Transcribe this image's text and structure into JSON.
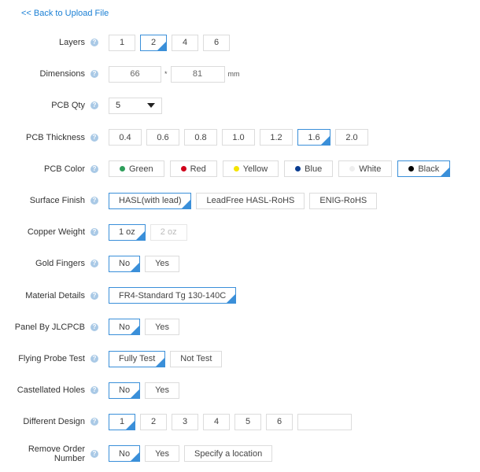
{
  "back_link": "<< Back to Upload File",
  "accent": "#3a8fd9",
  "rows": [
    {
      "key": "layers",
      "label": "Layers",
      "options": [
        "1",
        "2",
        "4",
        "6"
      ],
      "selected": "2"
    },
    {
      "key": "dimensions",
      "label": "Dimensions",
      "type": "dimensions",
      "width": "66",
      "height": "81",
      "separator": "*",
      "unit": "mm"
    },
    {
      "key": "pcb-qty",
      "label": "PCB Qty",
      "type": "select",
      "value": "5"
    },
    {
      "key": "pcb-thickness",
      "label": "PCB Thickness",
      "options": [
        "0.4",
        "0.6",
        "0.8",
        "1.0",
        "1.2",
        "1.6",
        "2.0"
      ],
      "selected": "1.6"
    },
    {
      "key": "pcb-color",
      "label": "PCB Color",
      "type": "color",
      "options": [
        {
          "label": "Green",
          "color": "#2e9e5b"
        },
        {
          "label": "Red",
          "color": "#d0021b"
        },
        {
          "label": "Yellow",
          "color": "#f5e400"
        },
        {
          "label": "Blue",
          "color": "#0a3d91"
        },
        {
          "label": "White",
          "color": "#eeeeee"
        },
        {
          "label": "Black",
          "color": "#000000"
        }
      ],
      "selected": "Black"
    },
    {
      "key": "surface-finish",
      "label": "Surface Finish",
      "options": [
        "HASL(with lead)",
        "LeadFree HASL-RoHS",
        "ENIG-RoHS"
      ],
      "selected": "HASL(with lead)"
    },
    {
      "key": "copper-weight",
      "label": "Copper Weight",
      "options": [
        "1 oz",
        "2 oz"
      ],
      "selected": "1 oz",
      "disabled": [
        "2 oz"
      ]
    },
    {
      "key": "gold-fingers",
      "label": "Gold Fingers",
      "options": [
        "No",
        "Yes"
      ],
      "selected": "No"
    },
    {
      "key": "material-details",
      "label": "Material Details",
      "options": [
        "FR4-Standard Tg 130-140C"
      ],
      "selected": "FR4-Standard Tg 130-140C"
    },
    {
      "key": "panel-by-jlcpcb",
      "label": "Panel By JLCPCB",
      "options": [
        "No",
        "Yes"
      ],
      "selected": "No"
    },
    {
      "key": "flying-probe-test",
      "label": "Flying Probe Test",
      "options": [
        "Fully Test",
        "Not Test"
      ],
      "selected": "Fully Test"
    },
    {
      "key": "castellated-holes",
      "label": "Castellated Holes",
      "options": [
        "No",
        "Yes"
      ],
      "selected": "No"
    },
    {
      "key": "different-design",
      "label": "Different Design",
      "options": [
        "1",
        "2",
        "3",
        "4",
        "5",
        "6"
      ],
      "selected": "1",
      "custom_input": ""
    },
    {
      "key": "remove-order-number",
      "label": "Remove Order Number",
      "options": [
        "No",
        "Yes",
        "Specify a location"
      ],
      "selected": "No"
    }
  ],
  "help_glyph": "?"
}
